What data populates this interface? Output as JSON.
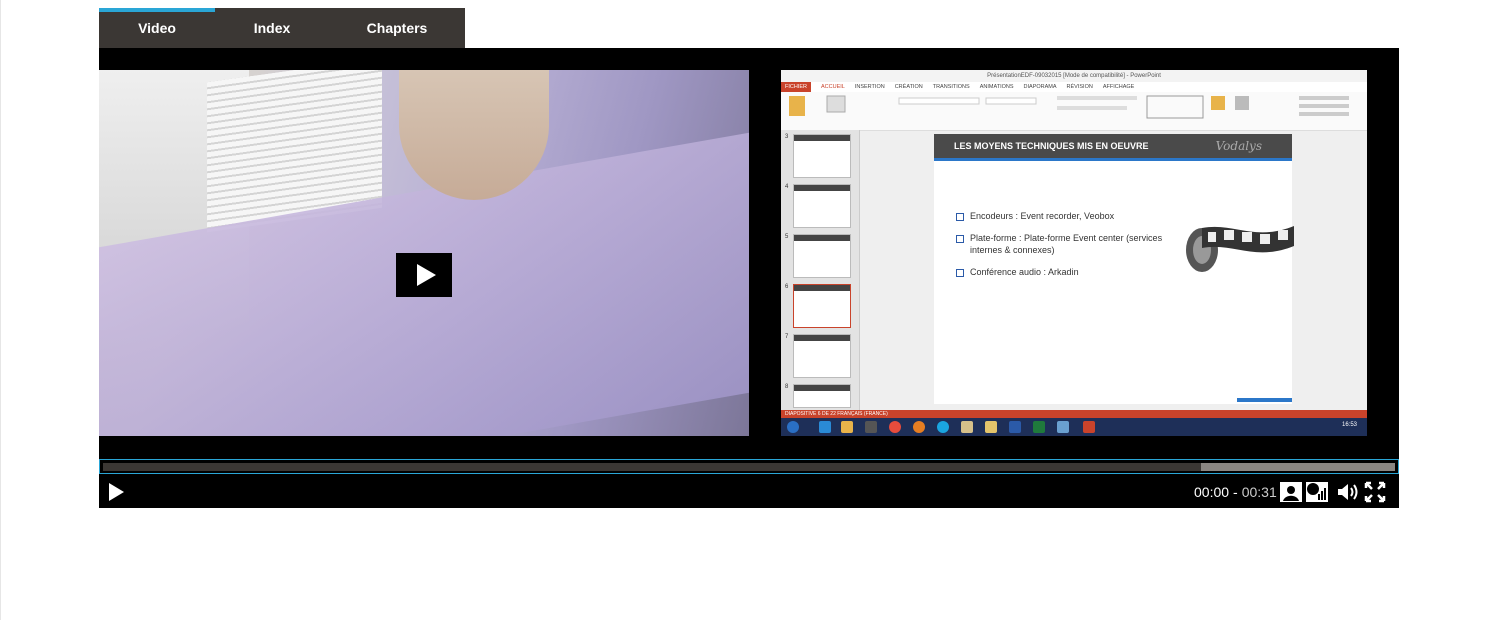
{
  "tabs": [
    {
      "label": "Video",
      "active": true
    },
    {
      "label": "Index",
      "active": false
    },
    {
      "label": "Chapters",
      "active": false
    }
  ],
  "player": {
    "current_time": "00:00",
    "separator": "-",
    "duration": "00:31",
    "progress_fraction": 0.0,
    "buffered_fraction": 0.85
  },
  "slides_pane": {
    "window_title": "PrésentationEDF-09032015 [Mode de compatibilité] - PowerPoint",
    "ribbon_tabs": [
      "FICHIER",
      "ACCUEIL",
      "INSERTION",
      "CRÉATION",
      "TRANSITIONS",
      "ANIMATIONS",
      "DIAPORAMA",
      "RÉVISION",
      "AFFICHAGE"
    ],
    "slide_numbers": [
      "3",
      "4",
      "5",
      "6",
      "7",
      "8"
    ],
    "slide": {
      "title": "LES MOYENS TECHNIQUES MIS EN OEUVRE",
      "logo": "Vodalys",
      "bullets": [
        "Encodeurs : Event recorder, Veobox",
        "Plate-forme : Plate-forme Event center (services internes & connexes)",
        "Conférence audio : Arkadin"
      ]
    },
    "status": "DIAPOSITIVE 6 DE 22     FRANÇAIS (FRANCE)",
    "clock": "16:53"
  },
  "colors": {
    "accent": "#2aa6d6",
    "tab_bg": "#3b3734",
    "player_bg": "#000000"
  },
  "icons": [
    "play-icon",
    "camera-view-icon",
    "slides-view-icon",
    "volume-icon",
    "fullscreen-icon"
  ]
}
